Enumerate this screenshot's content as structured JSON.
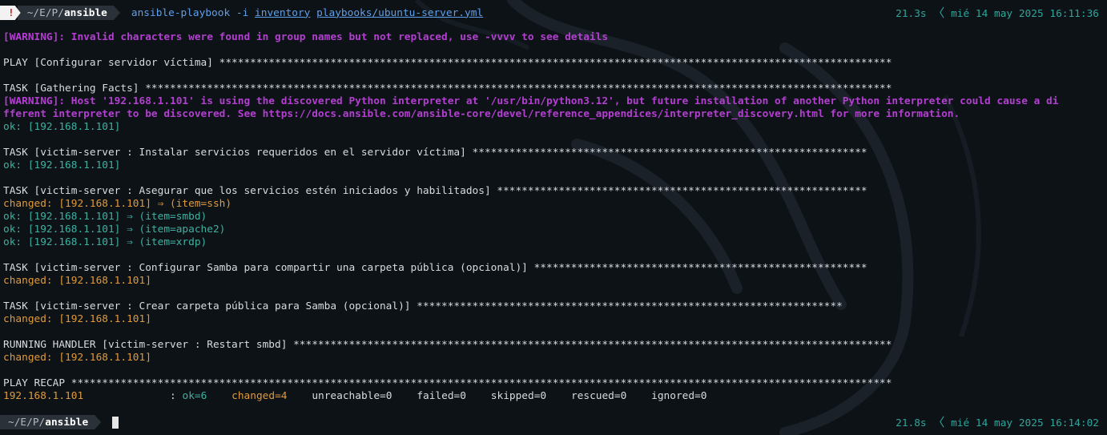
{
  "prompt1": {
    "status": "!",
    "path_prefix": "~/E/P/",
    "path_dir": "ansible",
    "cmd_bin": "ansible-playbook",
    "cmd_flag": "-i",
    "cmd_inventory": "inventory",
    "cmd_playbook": "playbooks/ubuntu-server.yml",
    "duration": "21.3s",
    "datetime": "mié 14 may 2025 16:11:36"
  },
  "output": {
    "warning1": "[WARNING]: Invalid characters were found in group names but not replaced, use -vvvv to see details",
    "play": "PLAY [Configurar servidor víctima] *************************************************************************************************************",
    "task_gather": "TASK [Gathering Facts] *************************************************************************************************************************",
    "warning2a": "[WARNING]: Host '192.168.1.101' is using the discovered Python interpreter at '/usr/bin/python3.12', but future installation of another Python interpreter could cause a di",
    "warning2b": "fferent interpreter to be discovered. See https://docs.ansible.com/ansible-core/devel/reference_appendices/interpreter_discovery.html for more information.",
    "ok_gather": "ok: [192.168.1.101]",
    "task_install": "TASK [victim-server : Instalar servicios requeridos en el servidor víctima] ****************************************************************",
    "ok_install": "ok: [192.168.1.101]",
    "task_ensure": "TASK [victim-server : Asegurar que los servicios estén iniciados y habilitados] ************************************************************",
    "ensure_ssh": "changed: [192.168.1.101] ⇒ (item=ssh)",
    "ensure_smbd": "ok: [192.168.1.101] ⇒ (item=smbd)",
    "ensure_apache": "ok: [192.168.1.101] ⇒ (item=apache2)",
    "ensure_xrdp": "ok: [192.168.1.101] ⇒ (item=xrdp)",
    "task_samba": "TASK [victim-server : Configurar Samba para compartir una carpeta pública (opcional)] ******************************************************",
    "changed_samba": "changed: [192.168.1.101]",
    "task_folder": "TASK [victim-server : Crear carpeta pública para Samba (opcional)] *********************************************************************",
    "changed_folder": "changed: [192.168.1.101]",
    "handler": "RUNNING HANDLER [victim-server : Restart smbd] *************************************************************************************************",
    "changed_handler": "changed: [192.168.1.101]",
    "recap": "PLAY RECAP *************************************************************************************************************************************",
    "recap_host": "192.168.1.101",
    "recap_colon": ":",
    "recap_ok": "ok=6",
    "recap_changed": "changed=4",
    "recap_unreachable": "unreachable=0",
    "recap_failed": "failed=0",
    "recap_skipped": "skipped=0",
    "recap_rescued": "rescued=0",
    "recap_ignored": "ignored=0"
  },
  "prompt2": {
    "path_prefix": "~/E/P/",
    "path_dir": "ansible",
    "duration": "21.8s",
    "datetime": "mié 14 may 2025 16:14:02"
  },
  "colors": {
    "background": "#0d1217",
    "warning": "#b33fd0",
    "ok": "#3fb0a0",
    "changed": "#e09a3c",
    "command": "#5f9fe9",
    "status_right": "#2fa59a"
  }
}
